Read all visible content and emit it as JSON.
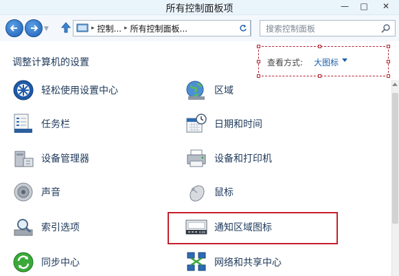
{
  "window": {
    "title": "所有控制面板项",
    "controls": {
      "minimize": "—",
      "maximize": "□",
      "close": "✕"
    }
  },
  "nav": {
    "back_icon": "back-arrow-icon",
    "forward_icon": "forward-arrow-icon",
    "address": {
      "crumbs": [
        "控制...",
        "所有控制面板..."
      ],
      "separator": "▸"
    },
    "search_placeholder": "搜索控制面板"
  },
  "header": {
    "title": "调整计算机的设置",
    "view_by_label": "查看方式:",
    "view_by_value": "大图标"
  },
  "items": {
    "left": [
      {
        "label": "轻松使用设置中心",
        "icon": "ease-of-access-icon"
      },
      {
        "label": "任务栏",
        "icon": "taskbar-icon"
      },
      {
        "label": "设备管理器",
        "icon": "device-manager-icon"
      },
      {
        "label": "声音",
        "icon": "sound-icon"
      },
      {
        "label": "索引选项",
        "icon": "indexing-options-icon"
      },
      {
        "label": "同步中心",
        "icon": "sync-center-icon"
      }
    ],
    "right": [
      {
        "label": "区域",
        "icon": "region-icon"
      },
      {
        "label": "日期和时间",
        "icon": "date-time-icon"
      },
      {
        "label": "设备和打印机",
        "icon": "devices-printers-icon"
      },
      {
        "label": "鼠标",
        "icon": "mouse-icon"
      },
      {
        "label": "通知区域图标",
        "icon": "notification-area-icons-icon"
      },
      {
        "label": "网络和共享中心",
        "icon": "network-sharing-icon"
      }
    ]
  },
  "colors": {
    "highlight_border": "#c41d2a",
    "link_blue": "#1a5fa8",
    "text_navy": "#1e395b"
  }
}
